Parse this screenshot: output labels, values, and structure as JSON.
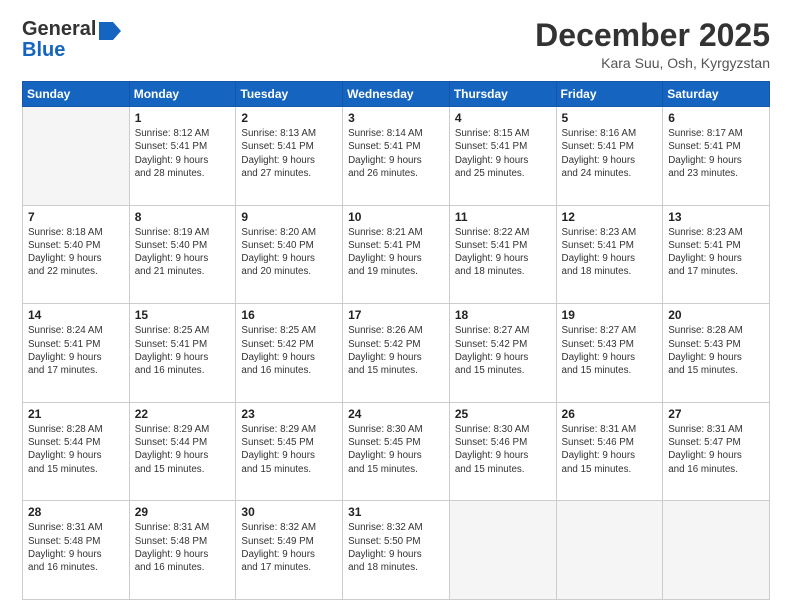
{
  "header": {
    "logo_line1": "General",
    "logo_line2": "Blue",
    "title": "December 2025",
    "subtitle": "Kara Suu, Osh, Kyrgyzstan"
  },
  "days_of_week": [
    "Sunday",
    "Monday",
    "Tuesday",
    "Wednesday",
    "Thursday",
    "Friday",
    "Saturday"
  ],
  "weeks": [
    [
      {
        "day": null,
        "info": null
      },
      {
        "day": "1",
        "info": "Sunrise: 8:12 AM\nSunset: 5:41 PM\nDaylight: 9 hours\nand 28 minutes."
      },
      {
        "day": "2",
        "info": "Sunrise: 8:13 AM\nSunset: 5:41 PM\nDaylight: 9 hours\nand 27 minutes."
      },
      {
        "day": "3",
        "info": "Sunrise: 8:14 AM\nSunset: 5:41 PM\nDaylight: 9 hours\nand 26 minutes."
      },
      {
        "day": "4",
        "info": "Sunrise: 8:15 AM\nSunset: 5:41 PM\nDaylight: 9 hours\nand 25 minutes."
      },
      {
        "day": "5",
        "info": "Sunrise: 8:16 AM\nSunset: 5:41 PM\nDaylight: 9 hours\nand 24 minutes."
      },
      {
        "day": "6",
        "info": "Sunrise: 8:17 AM\nSunset: 5:41 PM\nDaylight: 9 hours\nand 23 minutes."
      }
    ],
    [
      {
        "day": "7",
        "info": "Sunrise: 8:18 AM\nSunset: 5:40 PM\nDaylight: 9 hours\nand 22 minutes."
      },
      {
        "day": "8",
        "info": "Sunrise: 8:19 AM\nSunset: 5:40 PM\nDaylight: 9 hours\nand 21 minutes."
      },
      {
        "day": "9",
        "info": "Sunrise: 8:20 AM\nSunset: 5:40 PM\nDaylight: 9 hours\nand 20 minutes."
      },
      {
        "day": "10",
        "info": "Sunrise: 8:21 AM\nSunset: 5:41 PM\nDaylight: 9 hours\nand 19 minutes."
      },
      {
        "day": "11",
        "info": "Sunrise: 8:22 AM\nSunset: 5:41 PM\nDaylight: 9 hours\nand 18 minutes."
      },
      {
        "day": "12",
        "info": "Sunrise: 8:23 AM\nSunset: 5:41 PM\nDaylight: 9 hours\nand 18 minutes."
      },
      {
        "day": "13",
        "info": "Sunrise: 8:23 AM\nSunset: 5:41 PM\nDaylight: 9 hours\nand 17 minutes."
      }
    ],
    [
      {
        "day": "14",
        "info": "Sunrise: 8:24 AM\nSunset: 5:41 PM\nDaylight: 9 hours\nand 17 minutes."
      },
      {
        "day": "15",
        "info": "Sunrise: 8:25 AM\nSunset: 5:41 PM\nDaylight: 9 hours\nand 16 minutes."
      },
      {
        "day": "16",
        "info": "Sunrise: 8:25 AM\nSunset: 5:42 PM\nDaylight: 9 hours\nand 16 minutes."
      },
      {
        "day": "17",
        "info": "Sunrise: 8:26 AM\nSunset: 5:42 PM\nDaylight: 9 hours\nand 15 minutes."
      },
      {
        "day": "18",
        "info": "Sunrise: 8:27 AM\nSunset: 5:42 PM\nDaylight: 9 hours\nand 15 minutes."
      },
      {
        "day": "19",
        "info": "Sunrise: 8:27 AM\nSunset: 5:43 PM\nDaylight: 9 hours\nand 15 minutes."
      },
      {
        "day": "20",
        "info": "Sunrise: 8:28 AM\nSunset: 5:43 PM\nDaylight: 9 hours\nand 15 minutes."
      }
    ],
    [
      {
        "day": "21",
        "info": "Sunrise: 8:28 AM\nSunset: 5:44 PM\nDaylight: 9 hours\nand 15 minutes."
      },
      {
        "day": "22",
        "info": "Sunrise: 8:29 AM\nSunset: 5:44 PM\nDaylight: 9 hours\nand 15 minutes."
      },
      {
        "day": "23",
        "info": "Sunrise: 8:29 AM\nSunset: 5:45 PM\nDaylight: 9 hours\nand 15 minutes."
      },
      {
        "day": "24",
        "info": "Sunrise: 8:30 AM\nSunset: 5:45 PM\nDaylight: 9 hours\nand 15 minutes."
      },
      {
        "day": "25",
        "info": "Sunrise: 8:30 AM\nSunset: 5:46 PM\nDaylight: 9 hours\nand 15 minutes."
      },
      {
        "day": "26",
        "info": "Sunrise: 8:31 AM\nSunset: 5:46 PM\nDaylight: 9 hours\nand 15 minutes."
      },
      {
        "day": "27",
        "info": "Sunrise: 8:31 AM\nSunset: 5:47 PM\nDaylight: 9 hours\nand 16 minutes."
      }
    ],
    [
      {
        "day": "28",
        "info": "Sunrise: 8:31 AM\nSunset: 5:48 PM\nDaylight: 9 hours\nand 16 minutes."
      },
      {
        "day": "29",
        "info": "Sunrise: 8:31 AM\nSunset: 5:48 PM\nDaylight: 9 hours\nand 16 minutes."
      },
      {
        "day": "30",
        "info": "Sunrise: 8:32 AM\nSunset: 5:49 PM\nDaylight: 9 hours\nand 17 minutes."
      },
      {
        "day": "31",
        "info": "Sunrise: 8:32 AM\nSunset: 5:50 PM\nDaylight: 9 hours\nand 18 minutes."
      },
      {
        "day": null,
        "info": null
      },
      {
        "day": null,
        "info": null
      },
      {
        "day": null,
        "info": null
      }
    ]
  ]
}
